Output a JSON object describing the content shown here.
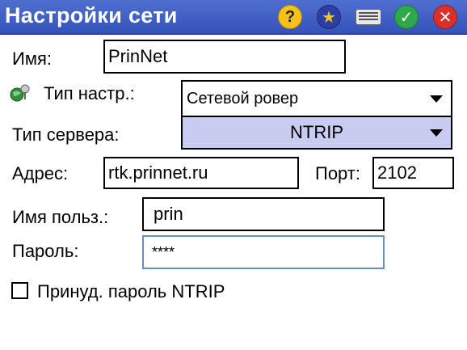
{
  "window": {
    "title": "Настройки сети"
  },
  "toolbar": {
    "icons": [
      "help-icon",
      "favorites-star-icon",
      "keyboard-icon",
      "ok-check-icon",
      "cancel-close-icon"
    ]
  },
  "form": {
    "name_label": "Имя:",
    "name_value": "PrinNet",
    "type_label": "Тип настр.:",
    "type_value": "Сетевой ровер",
    "server_type_label": "Тип сервера:",
    "server_type_value": "NTRIP",
    "address_label": "Адрес:",
    "address_value": "rtk.prinnet.ru",
    "port_label": "Порт:",
    "port_value": "2102",
    "user_label": "Имя польз.:",
    "user_value": "prin",
    "password_label": "Пароль:",
    "password_value": "****",
    "force_ntrip_label": "Принуд. пароль NTRIP"
  },
  "colors": {
    "titlebar": "#3553b8",
    "ntrip_select_bg": "#c9cbf0"
  }
}
